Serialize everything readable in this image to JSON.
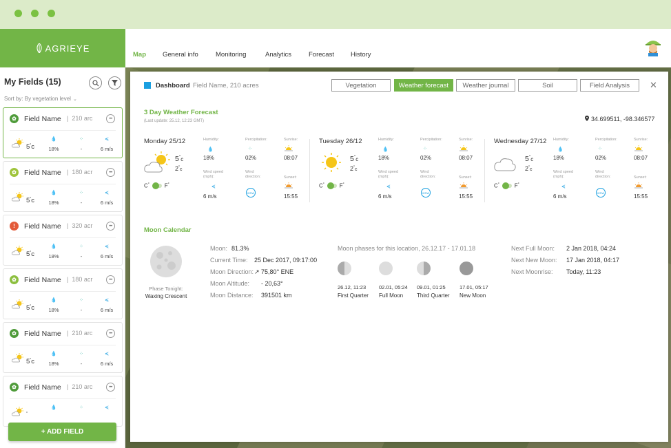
{
  "app": {
    "name": "AGRIEYE"
  },
  "nav": {
    "tabs": [
      "Map",
      "General info",
      "Monitoring",
      "Analytics",
      "Forecast",
      "History"
    ],
    "active": "Map"
  },
  "sidebar": {
    "title": "My Fields (15)",
    "sort": "Sort by: By vegetation level",
    "add_button": "+ ADD FIELD",
    "fields": [
      {
        "name": "Field Name",
        "area": "210 arc",
        "status": "ok",
        "temp": "5",
        "unit": "c",
        "humidity": "18%",
        "precip": "-",
        "wind": "6 m/s"
      },
      {
        "name": "Field Name",
        "area": "180 acr",
        "status": "warn",
        "temp": "5",
        "unit": "c",
        "humidity": "18%",
        "precip": "-",
        "wind": "6 m/s"
      },
      {
        "name": "Field Name",
        "area": "320 acr",
        "status": "alert",
        "temp": "5",
        "unit": "c",
        "humidity": "18%",
        "precip": "-",
        "wind": "6 m/s"
      },
      {
        "name": "Field Name",
        "area": "180 acr",
        "status": "mid",
        "temp": "5",
        "unit": "c",
        "humidity": "18%",
        "precip": "-",
        "wind": "6 m/s"
      },
      {
        "name": "Field Name",
        "area": "210 arc",
        "status": "ok",
        "temp": "5",
        "unit": "c",
        "humidity": "18%",
        "precip": "-",
        "wind": "6 m/s"
      },
      {
        "name": "Field Name",
        "area": "210 arc",
        "status": "ok",
        "temp": "",
        "unit": "",
        "humidity": "",
        "precip": "",
        "wind": ""
      }
    ]
  },
  "panel": {
    "title": "Dashboard",
    "subtitle": "Field Name, 210 acres",
    "tabs": [
      "Vegetation",
      "Weather forecast",
      "Weather journal",
      "Soil",
      "Field Analysis"
    ],
    "active_tab": "Weather forecast",
    "close": "✕"
  },
  "forecast": {
    "title": "3 Day Weather Forecast",
    "updated": "(Last update: 25.12, 12:23 GMT)",
    "location": "34.699511, -98.346577",
    "labels": {
      "humidity": "Humidity:",
      "precip": "Percipitation:",
      "sunrise": "Sunrise:",
      "wind_speed": "Wind speed (mph):",
      "wind_dir": "Wind direction:",
      "sunset": "Sunset:"
    },
    "units": {
      "c": "C",
      "f": "F",
      "deg": "°"
    },
    "days": [
      {
        "name": "Monday 25/12",
        "icon": "sun-cloud",
        "high": "5",
        "low": "2",
        "unit": "c",
        "humidity": "18%",
        "precip": "02%",
        "sunrise": "08:07",
        "wind": "6 m/s",
        "wind_dir": "WSW",
        "sunset": "15:55"
      },
      {
        "name": "Tuesday 26/12",
        "icon": "sun",
        "high": "5",
        "low": "2",
        "unit": "c",
        "humidity": "18%",
        "precip": "02%",
        "sunrise": "08:07",
        "wind": "6 m/s",
        "wind_dir": "WSW",
        "sunset": "15:55"
      },
      {
        "name": "Wednesday 27/12",
        "icon": "cloud",
        "high": "5",
        "low": "2",
        "unit": "c",
        "humidity": "18%",
        "precip": "02%",
        "sunrise": "08:07",
        "wind": "6 m/s",
        "wind_dir": "WSW",
        "sunset": "15:55"
      }
    ]
  },
  "moon": {
    "title": "Moon Calendar",
    "phase_label": "Phase Tonight:",
    "phase": "Waxing Crescent",
    "details": [
      {
        "label": "Moon:",
        "value": "81.3%"
      },
      {
        "label": "Current Time:",
        "value": "25 Dec 2017, 09:17:00"
      },
      {
        "label": "Moon Direction:",
        "value": "↗ 75,80° ENE"
      },
      {
        "label": "Moon Altitude:",
        "value": "- 20,63°"
      },
      {
        "label": "Moon Distance:",
        "value": "391501 km"
      }
    ],
    "phases_title": "Moon phases for this location, 26.12.17 - 17.01.18",
    "phases": [
      {
        "date": "26.12, 11:23",
        "name": "First Quarter",
        "kind": "half-left"
      },
      {
        "date": "02.01, 05:24",
        "name": "Full Moon",
        "kind": "full"
      },
      {
        "date": "09.01, 01:25",
        "name": "Third Quarter",
        "kind": "half-right"
      },
      {
        "date": "17.01, 05:17",
        "name": "New Moon",
        "kind": "new"
      }
    ],
    "next": [
      {
        "label": "Next Full Moon:",
        "value": "2 Jan 2018, 04:24"
      },
      {
        "label": "Next New Moon:",
        "value": "17 Jan 2018, 04:17"
      },
      {
        "label": "Next Moonrise:",
        "value": "Today, 11:23"
      }
    ]
  },
  "colors": {
    "brand": "#72b547",
    "accent_blue": "#1a9fe0",
    "alert": "#e35b3a"
  }
}
